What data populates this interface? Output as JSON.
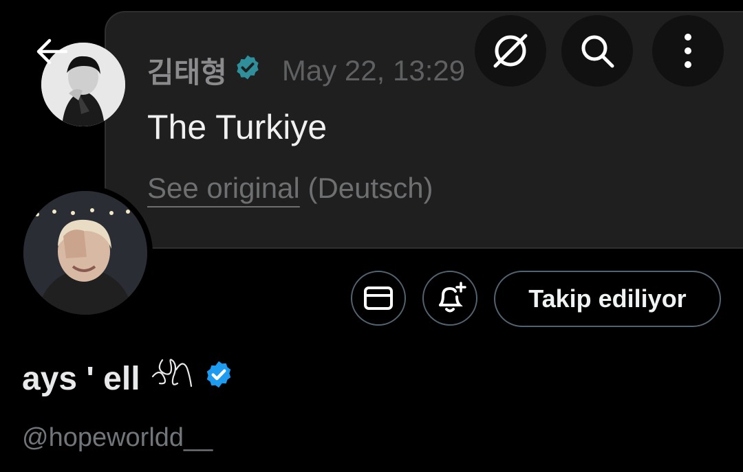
{
  "header": {
    "back_icon": "arrow-left-icon",
    "icons": [
      "grok-icon",
      "search-icon",
      "more-vertical-icon"
    ]
  },
  "quoted_post": {
    "author": "김태형",
    "verified_color": "#1d9bf0",
    "time": "May 22, 13:29",
    "text": "The Turkiye",
    "see_original": "See original",
    "language": "(Deutsch)"
  },
  "profile": {
    "display_name": "ays ' ell",
    "name_symbol": "ᢀᢀ",
    "verified_color": "#1d9bf0",
    "handle": "@hopeworldd__",
    "follow_label": "Takip ediliyor",
    "message_icon": "envelope-icon",
    "notify_icon": "bell-plus-icon"
  }
}
